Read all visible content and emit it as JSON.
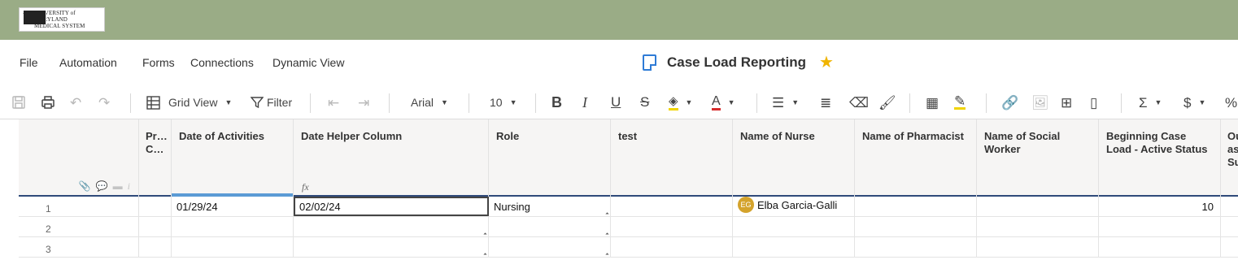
{
  "brand": {
    "logo_text_line1": "UNIVERSITY of MARYLAND",
    "logo_text_line2": "MEDICAL SYSTEM",
    "bar_color": "#9aac86"
  },
  "menu": {
    "items": [
      "File",
      "Automation",
      "Forms",
      "Connections",
      "Dynamic View"
    ]
  },
  "document": {
    "title": "Case Load Reporting",
    "favorite_icon": "star-icon",
    "favorited": true
  },
  "toolbar": {
    "view_label": "Grid View",
    "filter_label": "Filter",
    "font_family": "Arial",
    "font_size": "10",
    "icons": [
      "save-icon",
      "print-icon",
      "undo-icon",
      "redo-icon",
      "grid-view-icon",
      "filter-icon",
      "outdent-icon",
      "indent-icon",
      "bold-icon",
      "italic-icon",
      "underline-icon",
      "strikethrough-icon",
      "fill-color-icon",
      "text-color-icon",
      "align-icon",
      "wrap-text-icon",
      "clear-format-icon",
      "format-painter-icon",
      "cell-border-icon",
      "highlight-icon",
      "link-icon",
      "image-icon",
      "insert-row-icon",
      "column-icon",
      "sum-icon",
      "currency-icon",
      "percent-icon"
    ]
  },
  "grid": {
    "columns": [
      {
        "label": "Pr… C…"
      },
      {
        "label": "Date of Activities"
      },
      {
        "label": "Date Helper Column",
        "formula_icon": "fx"
      },
      {
        "label": "Role"
      },
      {
        "label": "test"
      },
      {
        "label": "Name of Nurse"
      },
      {
        "label": "Name of Pharmacist"
      },
      {
        "label": "Name of Social Worker"
      },
      {
        "label": "Beginning Case Load - Active Status"
      },
      {
        "label": "Ou as Su"
      }
    ],
    "rows": [
      {
        "num": "1",
        "date_of_activities": "01/29/24",
        "date_helper": "02/02/24",
        "role": "Nursing",
        "test": "",
        "nurse_initials": "EG",
        "nurse": "Elba Garcia-Galli",
        "pharmacist": "",
        "social_worker": "",
        "beginning_case_load": "10"
      },
      {
        "num": "2"
      },
      {
        "num": "3"
      }
    ]
  }
}
